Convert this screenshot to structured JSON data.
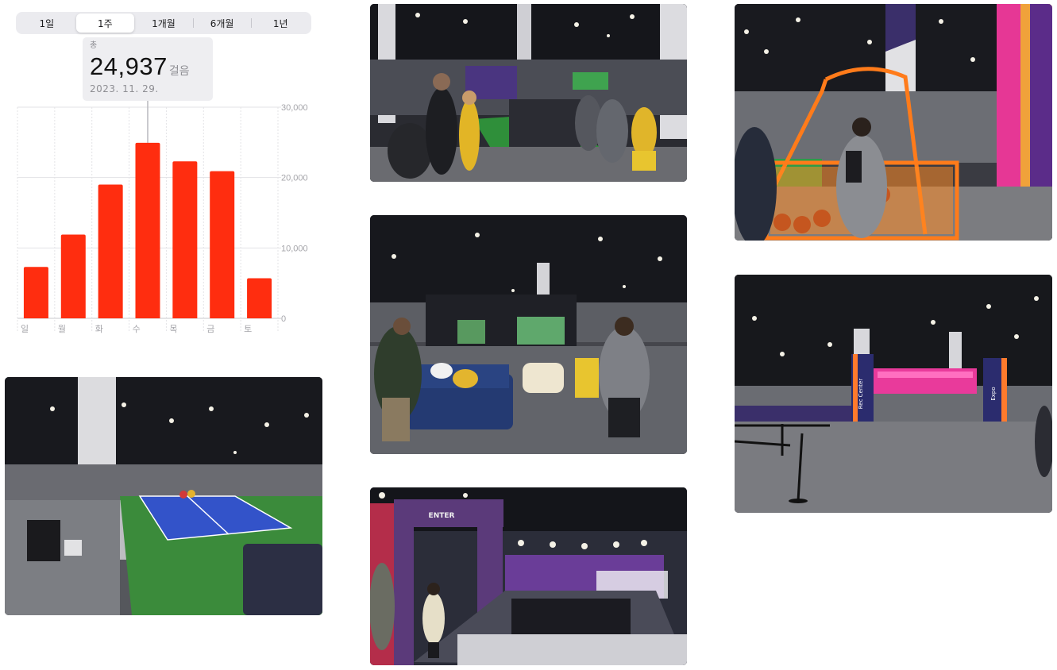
{
  "segments": [
    {
      "label": "1일"
    },
    {
      "label": "1주"
    },
    {
      "label": "1개월"
    },
    {
      "label": "6개월"
    },
    {
      "label": "1년"
    }
  ],
  "selected_segment": "1주",
  "callout": {
    "label": "총",
    "value": "24,937",
    "unit": "걸음",
    "date": "2023. 11. 29."
  },
  "chart_data": {
    "type": "bar",
    "categories": [
      "일",
      "월",
      "화",
      "수",
      "목",
      "금",
      "토"
    ],
    "values": [
      7300,
      11900,
      19000,
      24937,
      22300,
      20900,
      5700
    ],
    "ylim": [
      0,
      30000
    ],
    "yticks": [
      "0",
      "10,000",
      "20,000",
      "30,000"
    ],
    "ytick_values": [
      0,
      10000,
      20000,
      30000
    ],
    "highlight_index": 3,
    "bar_color": "#ff2d0f",
    "grid": true
  },
  "photos": [
    {
      "name": "photo-football-field-booth"
    },
    {
      "name": "photo-basketball-arcade"
    },
    {
      "name": "photo-lounge-sports-simulator"
    },
    {
      "name": "photo-convention-hall-entrance",
      "signs": [
        "Rec Center",
        "Expo"
      ]
    },
    {
      "name": "photo-pickleball-court"
    },
    {
      "name": "photo-soccer-enter-gate",
      "sign": "ENTER"
    }
  ],
  "colors": {
    "bar": "#ff2d0f",
    "accent_pink": "#e8328c",
    "accent_purple": "#5a2d8c"
  }
}
